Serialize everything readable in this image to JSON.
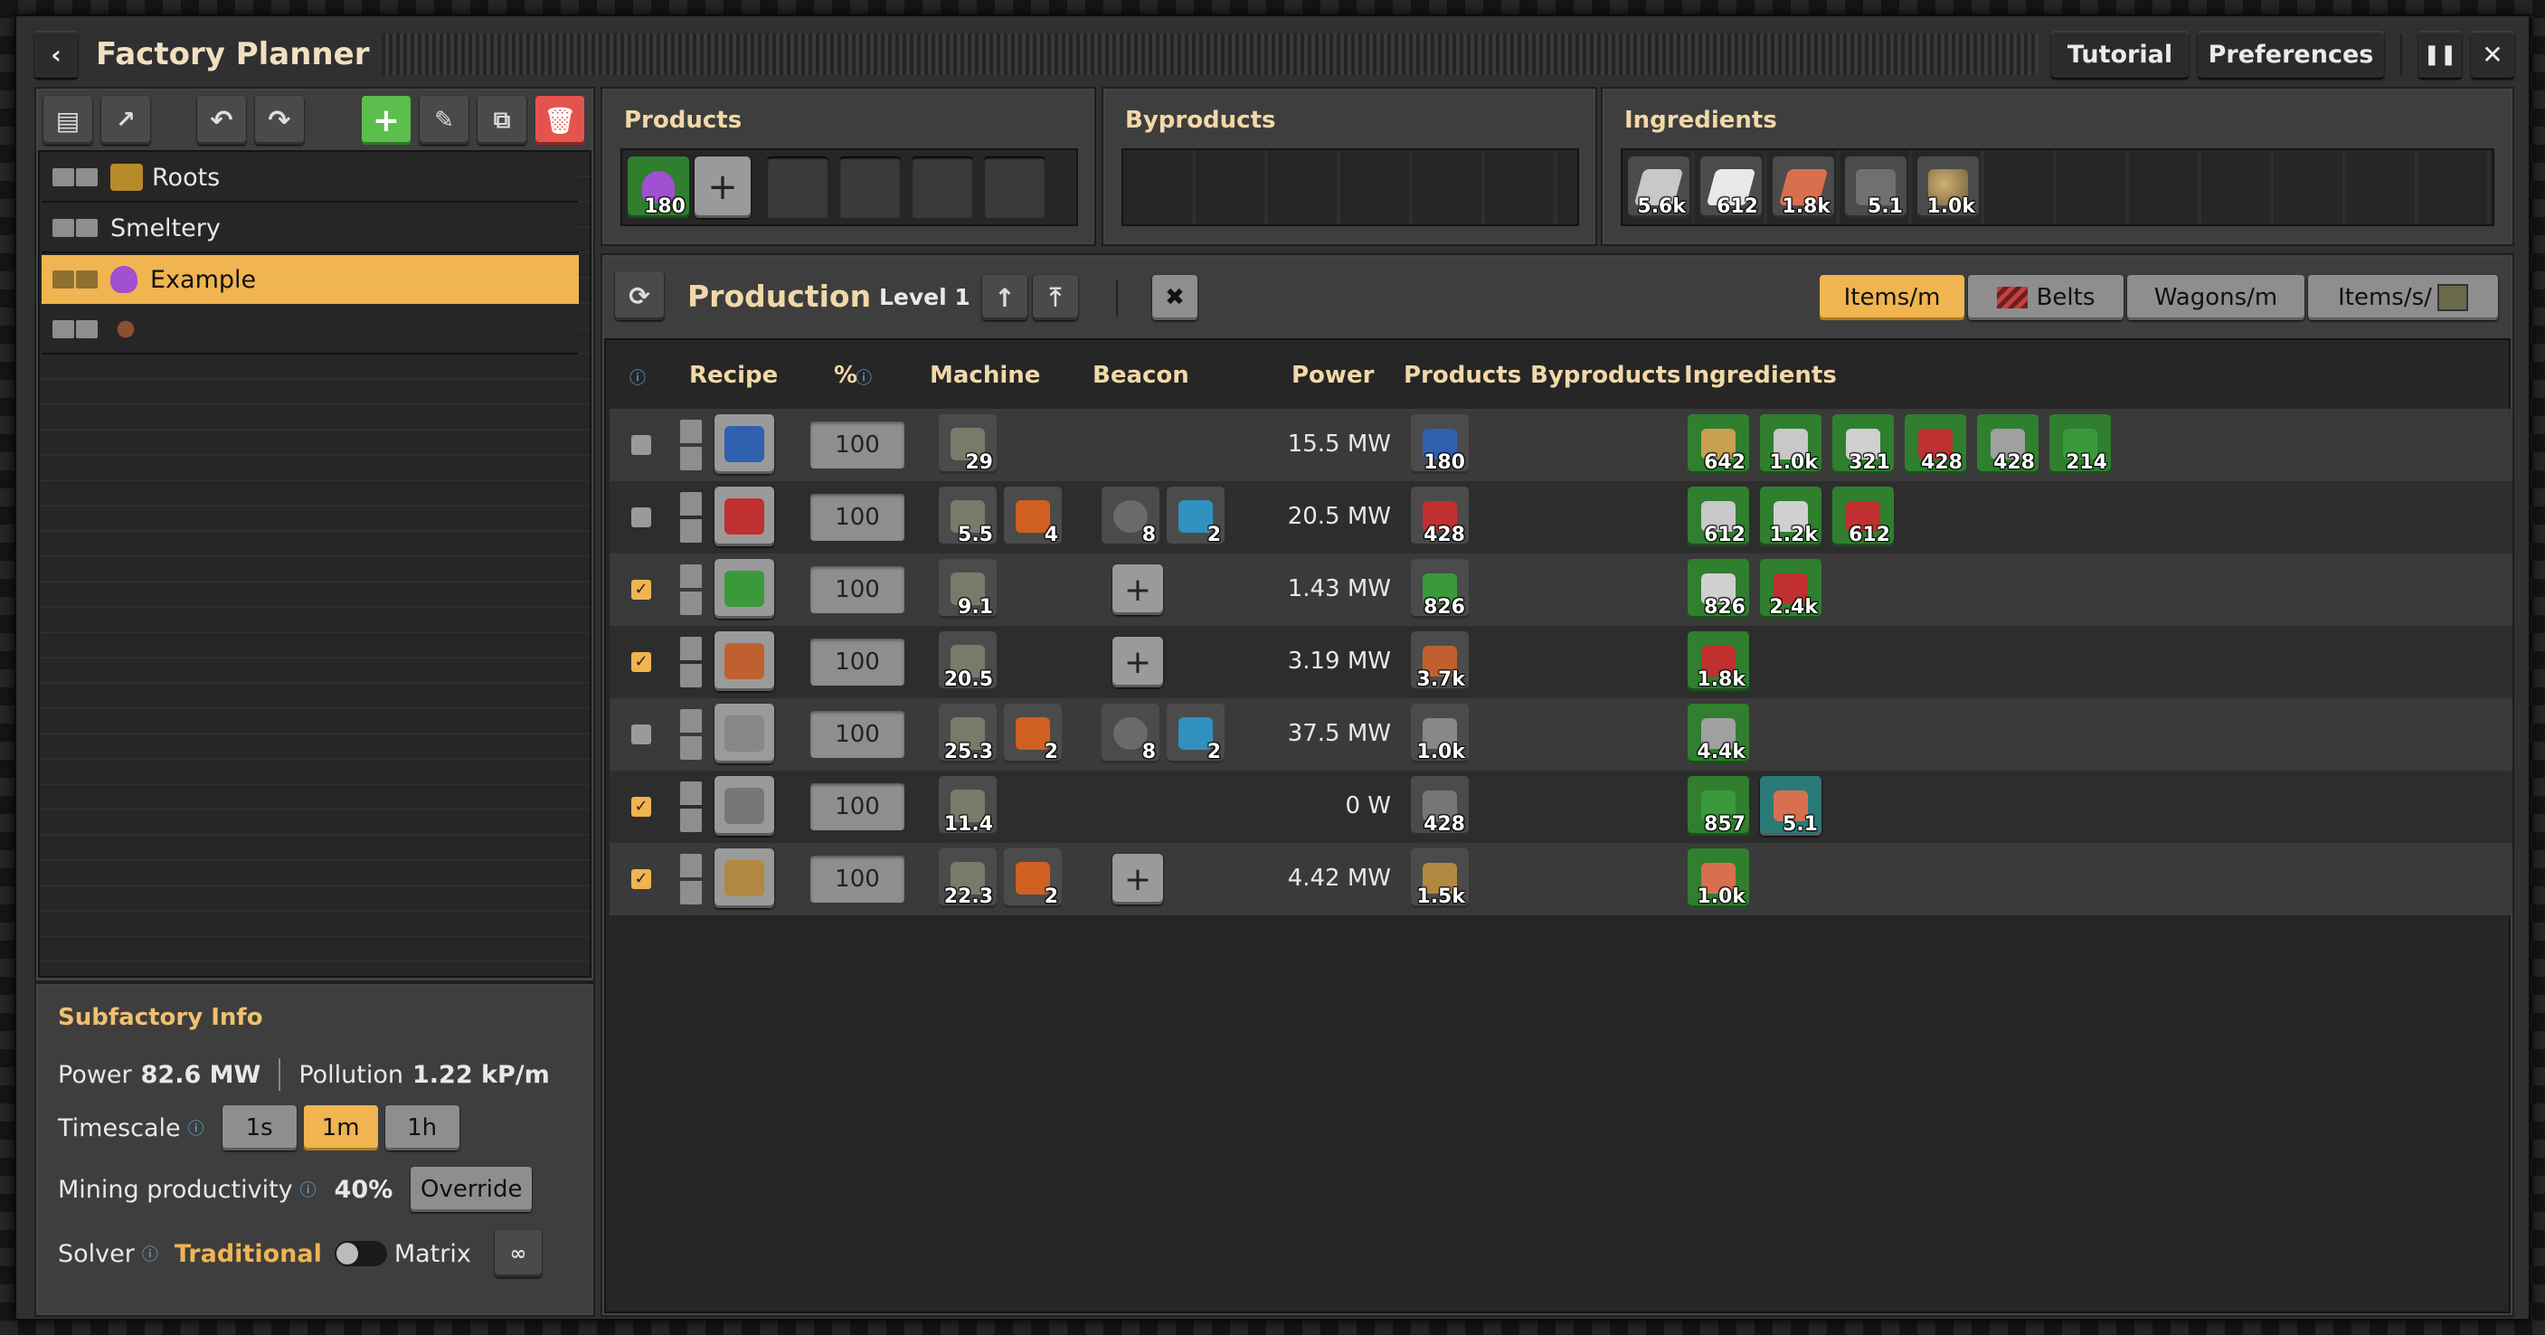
{
  "window": {
    "title": "Factory Planner",
    "tutorial": "Tutorial",
    "preferences": "Preferences"
  },
  "sidebar": {
    "items": [
      {
        "label": "Roots",
        "icon": "roots-icon"
      },
      {
        "label": "Smeltery",
        "icon": ""
      },
      {
        "label": "Example",
        "icon": "purple-flask-icon",
        "selected": true
      },
      {
        "label": "",
        "icon": "spider-icon"
      }
    ]
  },
  "subfactory_info": {
    "title": "Subfactory Info",
    "power_label": "Power",
    "power_value": "82.6 MW",
    "pollution_label": "Pollution",
    "pollution_value": "1.22 kP/m",
    "timescale_label": "Timescale",
    "timescale_options": [
      "1s",
      "1m",
      "1h"
    ],
    "timescale_selected": "1m",
    "mining_label": "Mining productivity",
    "mining_value": "40%",
    "override_label": "Override",
    "solver_label": "Solver",
    "solver_traditional": "Traditional",
    "solver_matrix": "Matrix"
  },
  "products_panel": {
    "title": "Products",
    "items": [
      {
        "value": "180",
        "icon": "purple-flask-icon"
      }
    ]
  },
  "byproducts_panel": {
    "title": "Byproducts"
  },
  "ingredients_panel": {
    "title": "Ingredients",
    "items": [
      {
        "value": "5.6k",
        "icon": "iron-plate-icon"
      },
      {
        "value": "612",
        "icon": "stone-tablet-icon"
      },
      {
        "value": "1.8k",
        "icon": "copper-plate-icon"
      },
      {
        "value": "5.1",
        "icon": "stone-brick-icon"
      },
      {
        "value": "1.0k",
        "icon": "stone-ore-icon"
      }
    ]
  },
  "production": {
    "title": "Production",
    "level": "Level 1",
    "views": [
      "Items/m",
      "Belts",
      "Wagons/m",
      "Items/s/"
    ],
    "view_selected": "Items/m",
    "columns": [
      "Recipe",
      "%",
      "Machine",
      "Beacon",
      "Power",
      "Products",
      "Byproducts",
      "Ingredients"
    ],
    "rows": [
      {
        "checked": false,
        "percent": "100",
        "recipe_color": "#3060b0",
        "machines": [
          {
            "v": "29"
          }
        ],
        "beacons": [],
        "beacon_add": false,
        "power": "15.5 MW",
        "products": [
          {
            "v": "180",
            "c": "#5a5a5a"
          }
        ],
        "ingredients": [
          "642",
          "1.0k",
          "321",
          "428",
          "428",
          "214"
        ]
      },
      {
        "checked": false,
        "percent": "100",
        "recipe_color": "#c03030",
        "machines": [
          {
            "v": "5.5"
          },
          {
            "v": "4"
          }
        ],
        "beacons": [
          {
            "v": "8"
          },
          {
            "v": "2"
          }
        ],
        "beacon_add": false,
        "power": "20.5 MW",
        "products": [
          {
            "v": "428",
            "c": "#5a5a5a"
          }
        ],
        "ingredients": [
          "612",
          "1.2k",
          "612"
        ]
      },
      {
        "checked": true,
        "percent": "100",
        "recipe_color": "#3a9a3a",
        "machines": [
          {
            "v": "9.1"
          }
        ],
        "beacons": [],
        "beacon_add": true,
        "power": "1.43 MW",
        "products": [
          {
            "v": "826",
            "c": "#5a5a5a"
          }
        ],
        "ingredients": [
          "826",
          "2.4k"
        ]
      },
      {
        "checked": true,
        "percent": "100",
        "recipe_color": "#c06030",
        "machines": [
          {
            "v": "20.5"
          }
        ],
        "beacons": [],
        "beacon_add": true,
        "power": "3.19 MW",
        "products": [
          {
            "v": "3.7k",
            "c": "#5a5a5a"
          }
        ],
        "ingredients": [
          "1.8k"
        ]
      },
      {
        "checked": false,
        "percent": "100",
        "recipe_color": "#888",
        "machines": [
          {
            "v": "25.3"
          },
          {
            "v": "2"
          }
        ],
        "beacons": [
          {
            "v": "8"
          },
          {
            "v": "2"
          }
        ],
        "beacon_add": false,
        "power": "37.5 MW",
        "products": [
          {
            "v": "1.0k",
            "c": "#5a5a5a"
          }
        ],
        "ingredients": [
          "4.4k"
        ]
      },
      {
        "checked": true,
        "percent": "100",
        "recipe_color": "#777",
        "machines": [
          {
            "v": "11.4"
          }
        ],
        "beacons": [],
        "beacon_add": false,
        "power": "0 W",
        "products": [
          {
            "v": "428",
            "c": "#5a5a5a"
          }
        ],
        "ingredients": [
          "857",
          "5.1"
        ]
      },
      {
        "checked": true,
        "percent": "100",
        "recipe_color": "#b08840",
        "machines": [
          {
            "v": "22.3"
          },
          {
            "v": "2"
          }
        ],
        "beacons": [],
        "beacon_add": true,
        "power": "4.42 MW",
        "products": [
          {
            "v": "1.5k",
            "c": "#5a5a5a"
          }
        ],
        "ingredients": [
          "1.0k"
        ]
      }
    ]
  },
  "colors": {
    "accent": "#f0b450",
    "selected": "#f0b450",
    "good": "#2f7f2f"
  }
}
